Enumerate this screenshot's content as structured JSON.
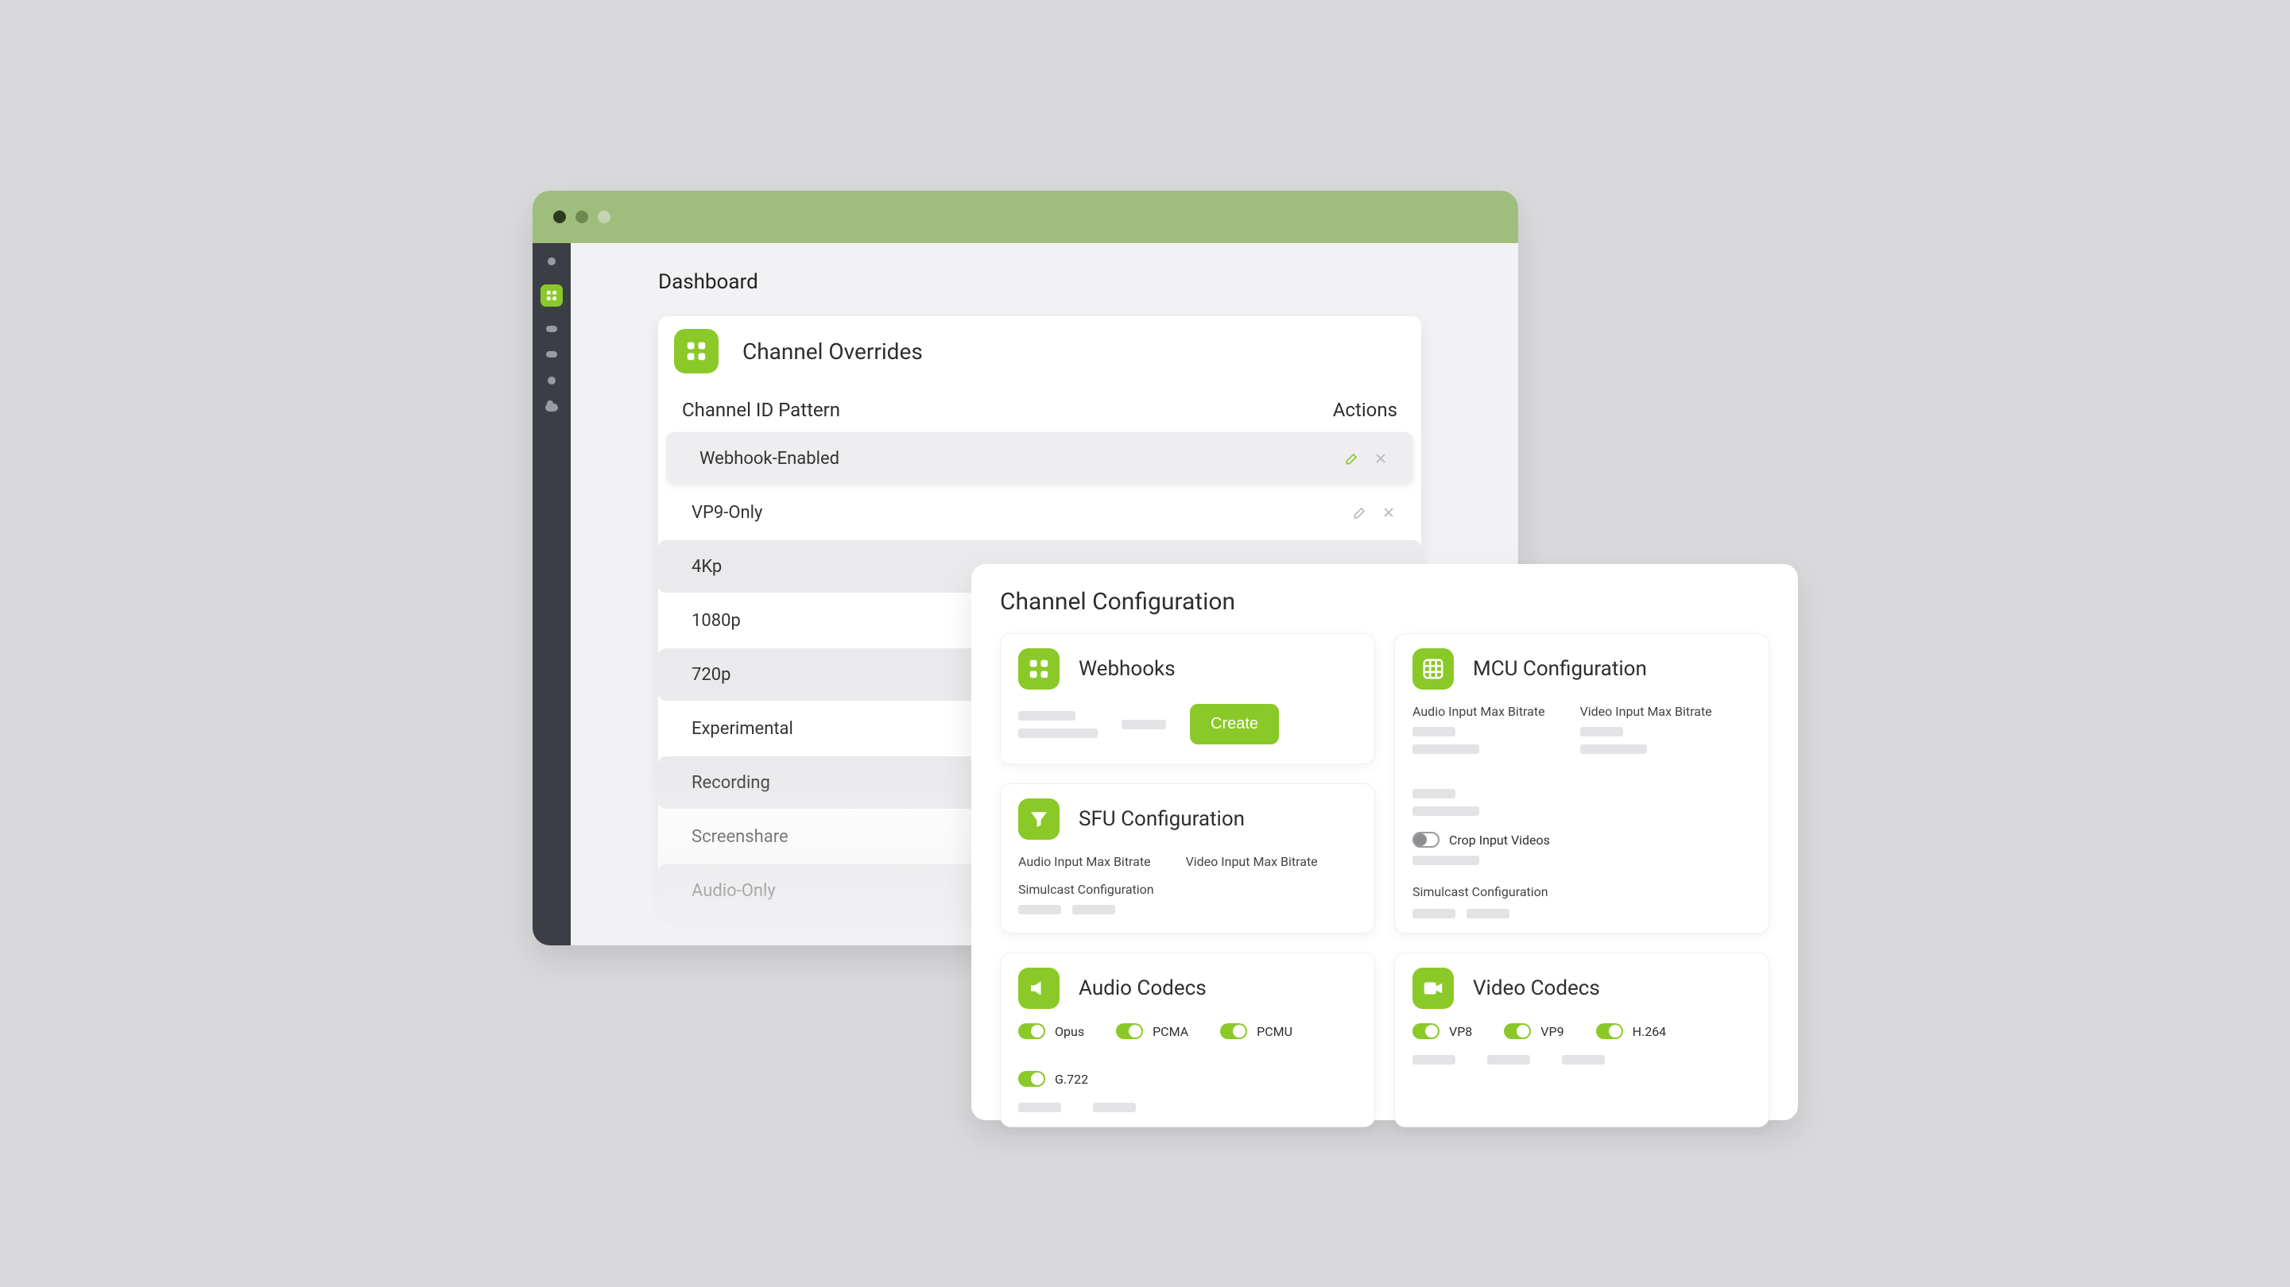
{
  "colors": {
    "accent": "#8ac928"
  },
  "window": {
    "page_title": "Dashboard",
    "panel_title": "Channel Overrides",
    "col_pattern": "Channel ID Pattern",
    "col_actions": "Actions",
    "rows": [
      {
        "label": "Webhook-Enabled",
        "selected": true,
        "show_actions": true,
        "actions_active": true
      },
      {
        "label": "VP9-Only",
        "selected": false,
        "show_actions": true,
        "actions_active": false
      },
      {
        "label": "4Kp",
        "selected": false,
        "show_actions": false
      },
      {
        "label": "1080p",
        "selected": false,
        "show_actions": false
      },
      {
        "label": "720p",
        "selected": false,
        "show_actions": false
      },
      {
        "label": "Experimental",
        "selected": false,
        "show_actions": false
      },
      {
        "label": "Recording",
        "selected": false,
        "show_actions": false
      },
      {
        "label": "Screenshare",
        "selected": false,
        "show_actions": false
      },
      {
        "label": "Audio-Only",
        "selected": false,
        "show_actions": false
      }
    ]
  },
  "pop": {
    "title": "Channel Configuration",
    "webhooks": {
      "title": "Webhooks",
      "create_label": "Create"
    },
    "sfu": {
      "title": "SFU Configuration",
      "audio_label": "Audio Input Max Bitrate",
      "video_label": "Video Input Max Bitrate",
      "simulcast_label": "Simulcast Configuration"
    },
    "mcu": {
      "title": "MCU Configuration",
      "audio_label": "Audio Input Max Bitrate",
      "video_label": "Video Input Max Bitrate",
      "crop_label": "Crop Input Videos",
      "crop_on": false,
      "simulcast_label": "Simulcast Configuration"
    },
    "audio_codecs": {
      "title": "Audio Codecs",
      "items": [
        {
          "name": "Opus",
          "on": true
        },
        {
          "name": "PCMA",
          "on": true
        },
        {
          "name": "PCMU",
          "on": true
        },
        {
          "name": "G.722",
          "on": true
        }
      ]
    },
    "video_codecs": {
      "title": "Video Codecs",
      "items": [
        {
          "name": "VP8",
          "on": true
        },
        {
          "name": "VP9",
          "on": true
        },
        {
          "name": "H.264",
          "on": true
        }
      ]
    }
  }
}
